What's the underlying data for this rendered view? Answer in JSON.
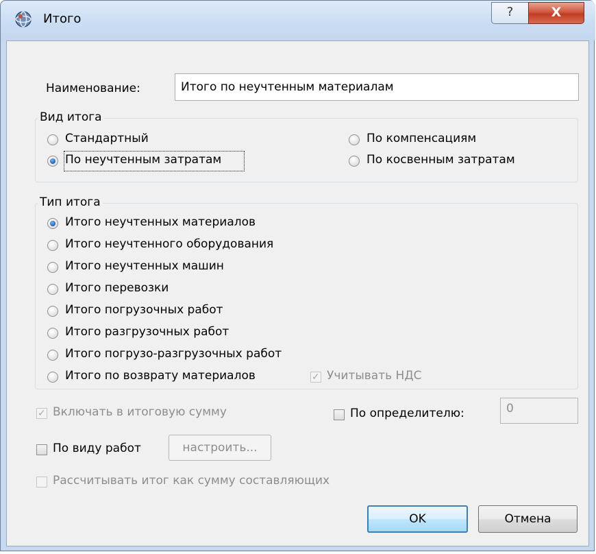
{
  "window": {
    "title": "Итого",
    "help_glyph": "?",
    "close_glyph": "X",
    "icon": "app-dialog-icon"
  },
  "name_field": {
    "label": "Наименование:",
    "value": "Итого по неучтенным материалам"
  },
  "total_kind": {
    "title": "Вид итога",
    "options": [
      {
        "label": "Стандартный",
        "selected": false
      },
      {
        "label": "По компенсациям",
        "selected": false
      },
      {
        "label": "По неучтенным затратам",
        "selected": true
      },
      {
        "label": "По косвенным затратам",
        "selected": false
      }
    ]
  },
  "total_type": {
    "title": "Тип итога",
    "options": [
      {
        "label": "Итого неучтенных материалов",
        "selected": true
      },
      {
        "label": "Итого неучтенного оборудования",
        "selected": false
      },
      {
        "label": "Итого неучтенных машин",
        "selected": false
      },
      {
        "label": "Итого перевозки",
        "selected": false
      },
      {
        "label": "Итого погрузочных работ",
        "selected": false
      },
      {
        "label": "Итого разгрузочных работ",
        "selected": false
      },
      {
        "label": "Итого погрузо-разгрузочных работ",
        "selected": false
      },
      {
        "label": "Итого по возврату материалов",
        "selected": false
      }
    ],
    "vat_checkbox": {
      "label": "Учитывать НДС",
      "checked": true,
      "enabled": false
    }
  },
  "options": {
    "include_in_total": {
      "label": "Включать в итоговую сумму",
      "checked": true,
      "enabled": false
    },
    "by_determinant": {
      "label": "По определителю:",
      "checked": false,
      "value": "0"
    },
    "by_work_type": {
      "label": "По виду работ",
      "checked": false
    },
    "configure_button": "настроить...",
    "calc_as_sum": {
      "label": "Рассчитывать итог как сумму составляющих",
      "checked": false,
      "enabled": false
    }
  },
  "buttons": {
    "ok": "OK",
    "cancel": "Отмена"
  }
}
